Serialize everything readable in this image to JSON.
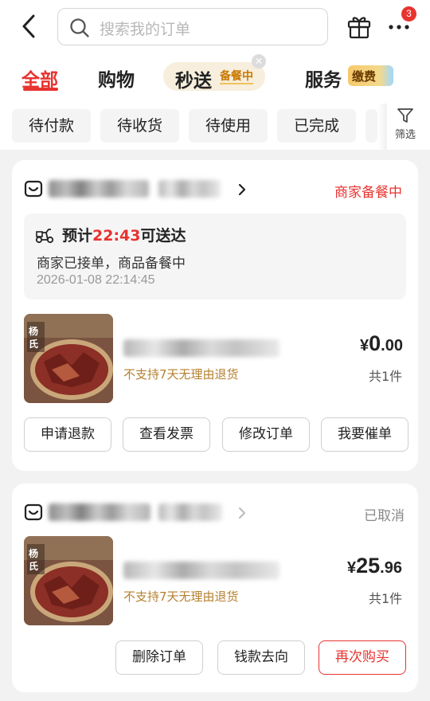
{
  "header": {
    "search_placeholder": "搜索我的订单",
    "more_badge_count": "3"
  },
  "tabs": {
    "all": "全部",
    "shopping": "购物",
    "flash": "秒送",
    "flash_sub": "备餐中",
    "service": "服务",
    "service_badge": "缴费"
  },
  "filters": {
    "chips": [
      "待付款",
      "待收货",
      "待使用",
      "已完成"
    ],
    "filter_label": "筛选"
  },
  "orders": [
    {
      "status": "商家备餐中",
      "eta_prefix": "预计",
      "eta_time": "22:43",
      "eta_suffix": "可送达",
      "notice": "商家已接单，商品备餐中",
      "timestamp": "2026-01-08 22:14:45",
      "policy": "不支持7天无理由退货",
      "price_currency": "¥",
      "price_int": "0",
      "price_dec": ".00",
      "quantity": "共1件",
      "actions": [
        "申请退款",
        "查看发票",
        "修改订单",
        "我要催单"
      ]
    },
    {
      "status": "已取消",
      "policy": "不支持7天无理由退货",
      "price_currency": "¥",
      "price_int": "25",
      "price_dec": ".96",
      "quantity": "共1件",
      "actions": [
        "删除订单",
        "钱款去向",
        "再次购买"
      ]
    }
  ],
  "colors": {
    "accent": "#e8332f",
    "policy": "#b5802f",
    "flash_bg": "#f7eedd"
  }
}
